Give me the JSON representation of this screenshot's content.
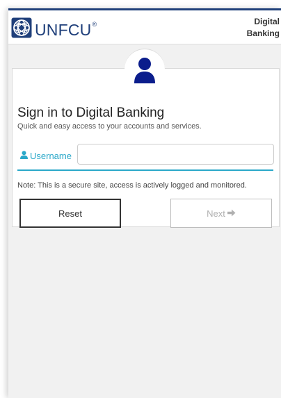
{
  "header": {
    "logo_text": "UNFCU",
    "logo_reg": "®",
    "title_line1": "Digital",
    "title_line2": "Banking"
  },
  "signin": {
    "title": "Sign in to Digital Banking",
    "subtitle": "Quick and easy access to your accounts and services.",
    "username_label": "Username",
    "username_value": "",
    "note": "Note: This is a secure site, access is actively logged and monitored.",
    "reset_label": "Reset",
    "next_label": "Next"
  },
  "icons": {
    "logo": "globe-logo-icon",
    "avatar": "user-avatar-icon",
    "username": "user-icon",
    "next": "arrow-right-icon"
  },
  "colors": {
    "brand": "#1f3f7a",
    "accent": "#2aa8c9",
    "avatar": "#0b1d8c",
    "disabled": "#b0b0b0"
  }
}
